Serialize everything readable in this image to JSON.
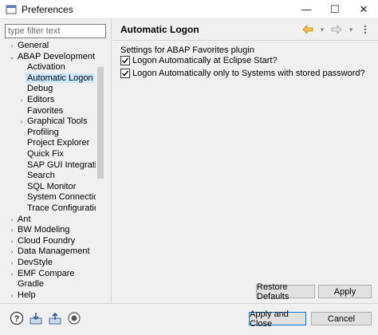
{
  "window": {
    "title": "Preferences",
    "minimize": "—",
    "maximize": "☐",
    "close": "✕"
  },
  "filter": {
    "placeholder": "type filter text"
  },
  "tree": [
    {
      "label": "General",
      "arrow": "›",
      "level": 0
    },
    {
      "label": "ABAP Development",
      "arrow": "⌄",
      "level": 0
    },
    {
      "label": "Activation",
      "arrow": "",
      "level": 1
    },
    {
      "label": "Automatic Logon",
      "arrow": "",
      "level": 1,
      "selected": true
    },
    {
      "label": "Debug",
      "arrow": "",
      "level": 1
    },
    {
      "label": "Editors",
      "arrow": "›",
      "level": 1
    },
    {
      "label": "Favorites",
      "arrow": "",
      "level": 1
    },
    {
      "label": "Graphical Tools",
      "arrow": "›",
      "level": 1
    },
    {
      "label": "Profiling",
      "arrow": "",
      "level": 1
    },
    {
      "label": "Project Explorer",
      "arrow": "",
      "level": 1
    },
    {
      "label": "Quick Fix",
      "arrow": "",
      "level": 1
    },
    {
      "label": "SAP GUI Integration",
      "arrow": "",
      "level": 1
    },
    {
      "label": "Search",
      "arrow": "",
      "level": 1
    },
    {
      "label": "SQL Monitor",
      "arrow": "",
      "level": 1
    },
    {
      "label": "System Connections",
      "arrow": "",
      "level": 1
    },
    {
      "label": "Trace Configuration",
      "arrow": "",
      "level": 1
    },
    {
      "label": "Ant",
      "arrow": "›",
      "level": 0
    },
    {
      "label": "BW Modeling",
      "arrow": "›",
      "level": 0
    },
    {
      "label": "Cloud Foundry",
      "arrow": "›",
      "level": 0
    },
    {
      "label": "Data Management",
      "arrow": "›",
      "level": 0
    },
    {
      "label": "DevStyle",
      "arrow": "›",
      "level": 0
    },
    {
      "label": "EMF Compare",
      "arrow": "›",
      "level": 0
    },
    {
      "label": "Gradle",
      "arrow": "",
      "level": 0
    },
    {
      "label": "Help",
      "arrow": "›",
      "level": 0
    }
  ],
  "page": {
    "title": "Automatic Logon",
    "description": "Settings for ABAP Favorites plugin",
    "checkboxes": [
      {
        "label": "Logon Automatically at Eclipse Start?",
        "checked": true
      },
      {
        "label": "Logon Automatically only to Systems with stored password?",
        "checked": true
      }
    ],
    "restore_defaults": "Restore Defaults",
    "apply": "Apply"
  },
  "footer": {
    "apply_and_close": "Apply and Close",
    "cancel": "Cancel"
  },
  "colors": {
    "selection": "#cce8ff",
    "primary_border": "#0078d7",
    "back_arrow": "#e8a317"
  }
}
